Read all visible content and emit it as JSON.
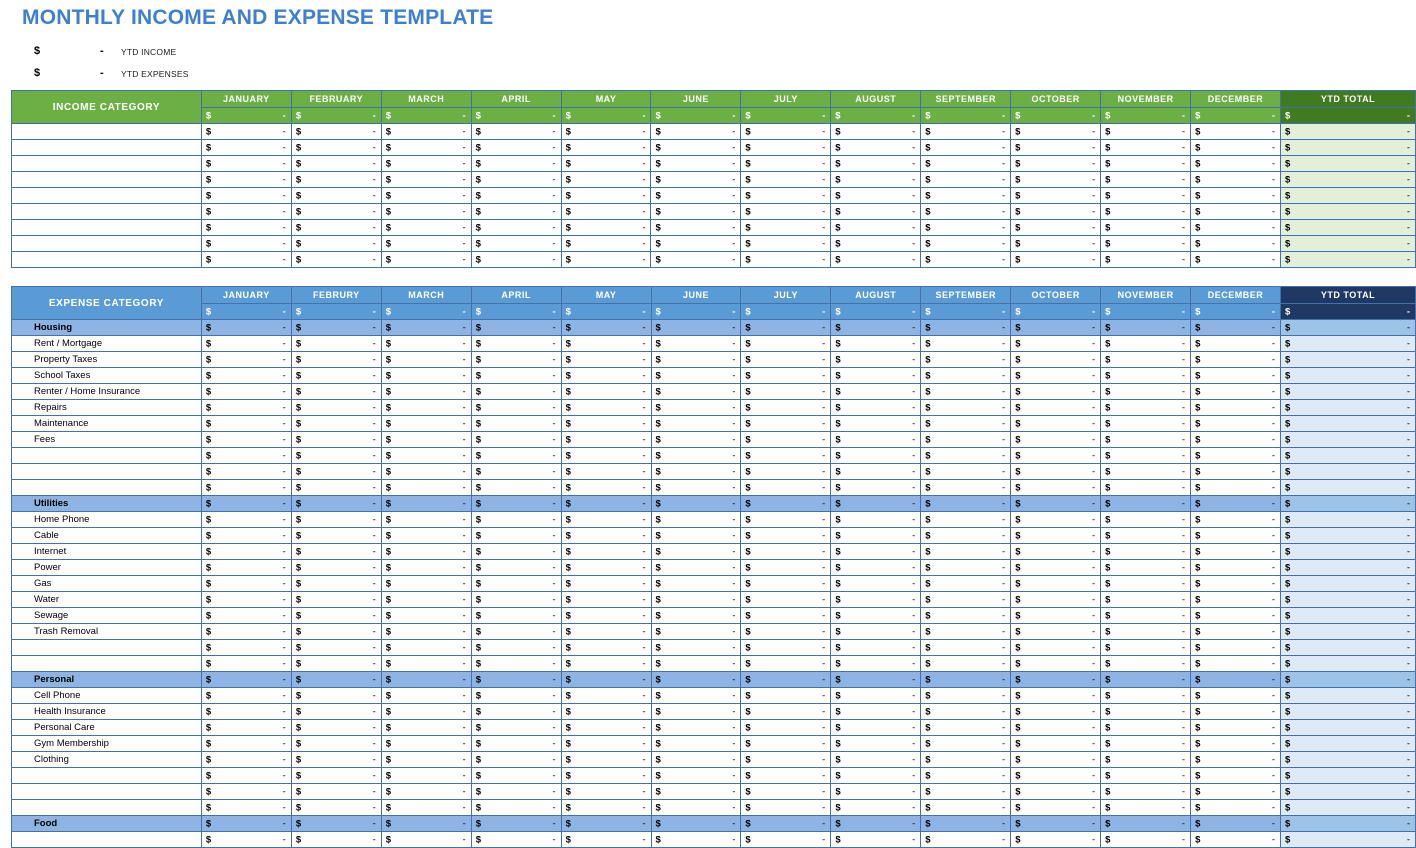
{
  "page": {
    "title": "MONTHLY INCOME AND EXPENSE TEMPLATE",
    "title_color": "#3F7FD0"
  },
  "summary": {
    "rows": [
      {
        "symbol": "$",
        "value": "-",
        "label": "YTD INCOME"
      },
      {
        "symbol": "$",
        "value": "-",
        "label": "YTD EXPENSES"
      }
    ]
  },
  "income_table": {
    "category_header": "INCOME CATEGORY",
    "months": [
      "JANUARY",
      "FEBRUARY",
      "MARCH",
      "APRIL",
      "MAY",
      "JUNE",
      "JULY",
      "AUGUST",
      "SEPTEMBER",
      "OCTOBER",
      "NOVEMBER",
      "DECEMBER"
    ],
    "ytd_header": "YTD TOTAL",
    "header_color": "#6CAF44",
    "ytd_header_color": "#417B21",
    "ytd_cell_color": "#E2EFDA",
    "currency_symbol": "$",
    "empty_value": "-",
    "total_row": {
      "months": [
        "-",
        "-",
        "-",
        "-",
        "-",
        "-",
        "-",
        "-",
        "-",
        "-",
        "-",
        "-"
      ],
      "ytd": "-"
    },
    "rows": [
      {
        "label": "",
        "months": [
          "-",
          "-",
          "-",
          "-",
          "-",
          "-",
          "-",
          "-",
          "-",
          "-",
          "-",
          "-"
        ],
        "ytd": "-"
      },
      {
        "label": "",
        "months": [
          "-",
          "-",
          "-",
          "-",
          "-",
          "-",
          "-",
          "-",
          "-",
          "-",
          "-",
          "-"
        ],
        "ytd": "-"
      },
      {
        "label": "",
        "months": [
          "-",
          "-",
          "-",
          "-",
          "-",
          "-",
          "-",
          "-",
          "-",
          "-",
          "-",
          "-"
        ],
        "ytd": "-"
      },
      {
        "label": "",
        "months": [
          "-",
          "-",
          "-",
          "-",
          "-",
          "-",
          "-",
          "-",
          "-",
          "-",
          "-",
          "-"
        ],
        "ytd": "-"
      },
      {
        "label": "",
        "months": [
          "-",
          "-",
          "-",
          "-",
          "-",
          "-",
          "-",
          "-",
          "-",
          "-",
          "-",
          "-"
        ],
        "ytd": "-"
      },
      {
        "label": "",
        "months": [
          "-",
          "-",
          "-",
          "-",
          "-",
          "-",
          "-",
          "-",
          "-",
          "-",
          "-",
          "-"
        ],
        "ytd": "-"
      },
      {
        "label": "",
        "months": [
          "-",
          "-",
          "-",
          "-",
          "-",
          "-",
          "-",
          "-",
          "-",
          "-",
          "-",
          "-"
        ],
        "ytd": "-"
      },
      {
        "label": "",
        "months": [
          "-",
          "-",
          "-",
          "-",
          "-",
          "-",
          "-",
          "-",
          "-",
          "-",
          "-",
          "-"
        ],
        "ytd": "-"
      },
      {
        "label": "",
        "months": [
          "-",
          "-",
          "-",
          "-",
          "-",
          "-",
          "-",
          "-",
          "-",
          "-",
          "-",
          "-"
        ],
        "ytd": "-"
      }
    ]
  },
  "expense_table": {
    "category_header": "EXPENSE CATEGORY",
    "months": [
      "JANUARY",
      "FEBRURY",
      "MARCH",
      "APRIL",
      "MAY",
      "JUNE",
      "JULY",
      "AUGUST",
      "SEPTEMBER",
      "OCTOBER",
      "NOVEMBER",
      "DECEMBER"
    ],
    "ytd_header": "YTD TOTAL",
    "header_color": "#5B9BD5",
    "ytd_header_color": "#1F3864",
    "ytd_cell_color": "#DEEBF7",
    "section_color": "#8EB4E3",
    "currency_symbol": "$",
    "empty_value": "-",
    "total_row": {
      "months": [
        "-",
        "-",
        "-",
        "-",
        "-",
        "-",
        "-",
        "-",
        "-",
        "-",
        "-",
        "-"
      ],
      "ytd": "-"
    },
    "rows": [
      {
        "label": "Housing",
        "type": "section",
        "months": [
          "-",
          "-",
          "-",
          "-",
          "-",
          "-",
          "-",
          "-",
          "-",
          "-",
          "-",
          "-"
        ],
        "ytd": "-"
      },
      {
        "label": "Rent / Mortgage",
        "type": "item",
        "months": [
          "-",
          "-",
          "-",
          "-",
          "-",
          "-",
          "-",
          "-",
          "-",
          "-",
          "-",
          "-"
        ],
        "ytd": "-"
      },
      {
        "label": "Property Taxes",
        "type": "item",
        "months": [
          "-",
          "-",
          "-",
          "-",
          "-",
          "-",
          "-",
          "-",
          "-",
          "-",
          "-",
          "-"
        ],
        "ytd": "-"
      },
      {
        "label": "School Taxes",
        "type": "item",
        "months": [
          "-",
          "-",
          "-",
          "-",
          "-",
          "-",
          "-",
          "-",
          "-",
          "-",
          "-",
          "-"
        ],
        "ytd": "-"
      },
      {
        "label": "Renter / Home Insurance",
        "type": "item",
        "months": [
          "-",
          "-",
          "-",
          "-",
          "-",
          "-",
          "-",
          "-",
          "-",
          "-",
          "-",
          "-"
        ],
        "ytd": "-"
      },
      {
        "label": "Repairs",
        "type": "item",
        "months": [
          "-",
          "-",
          "-",
          "-",
          "-",
          "-",
          "-",
          "-",
          "-",
          "-",
          "-",
          "-"
        ],
        "ytd": "-"
      },
      {
        "label": "Maintenance",
        "type": "item",
        "months": [
          "-",
          "-",
          "-",
          "-",
          "-",
          "-",
          "-",
          "-",
          "-",
          "-",
          "-",
          "-"
        ],
        "ytd": "-"
      },
      {
        "label": "Fees",
        "type": "item",
        "months": [
          "-",
          "-",
          "-",
          "-",
          "-",
          "-",
          "-",
          "-",
          "-",
          "-",
          "-",
          "-"
        ],
        "ytd": "-"
      },
      {
        "label": "",
        "type": "item",
        "months": [
          "-",
          "-",
          "-",
          "-",
          "-",
          "-",
          "-",
          "-",
          "-",
          "-",
          "-",
          "-"
        ],
        "ytd": "-"
      },
      {
        "label": "",
        "type": "item",
        "months": [
          "-",
          "-",
          "-",
          "-",
          "-",
          "-",
          "-",
          "-",
          "-",
          "-",
          "-",
          "-"
        ],
        "ytd": "-"
      },
      {
        "label": "",
        "type": "item",
        "months": [
          "-",
          "-",
          "-",
          "-",
          "-",
          "-",
          "-",
          "-",
          "-",
          "-",
          "-",
          "-"
        ],
        "ytd": "-"
      },
      {
        "label": "Utilities",
        "type": "section",
        "months": [
          "-",
          "-",
          "-",
          "-",
          "-",
          "-",
          "-",
          "-",
          "-",
          "-",
          "-",
          "-"
        ],
        "ytd": "-"
      },
      {
        "label": "Home Phone",
        "type": "item",
        "months": [
          "-",
          "-",
          "-",
          "-",
          "-",
          "-",
          "-",
          "-",
          "-",
          "-",
          "-",
          "-"
        ],
        "ytd": "-"
      },
      {
        "label": "Cable",
        "type": "item",
        "months": [
          "-",
          "-",
          "-",
          "-",
          "-",
          "-",
          "-",
          "-",
          "-",
          "-",
          "-",
          "-"
        ],
        "ytd": "-"
      },
      {
        "label": "Internet",
        "type": "item",
        "months": [
          "-",
          "-",
          "-",
          "-",
          "-",
          "-",
          "-",
          "-",
          "-",
          "-",
          "-",
          "-"
        ],
        "ytd": "-"
      },
      {
        "label": "Power",
        "type": "item",
        "months": [
          "-",
          "-",
          "-",
          "-",
          "-",
          "-",
          "-",
          "-",
          "-",
          "-",
          "-",
          "-"
        ],
        "ytd": "-"
      },
      {
        "label": "Gas",
        "type": "item",
        "months": [
          "-",
          "-",
          "-",
          "-",
          "-",
          "-",
          "-",
          "-",
          "-",
          "-",
          "-",
          "-"
        ],
        "ytd": "-"
      },
      {
        "label": "Water",
        "type": "item",
        "months": [
          "-",
          "-",
          "-",
          "-",
          "-",
          "-",
          "-",
          "-",
          "-",
          "-",
          "-",
          "-"
        ],
        "ytd": "-"
      },
      {
        "label": "Sewage",
        "type": "item",
        "months": [
          "-",
          "-",
          "-",
          "-",
          "-",
          "-",
          "-",
          "-",
          "-",
          "-",
          "-",
          "-"
        ],
        "ytd": "-"
      },
      {
        "label": "Trash Removal",
        "type": "item",
        "months": [
          "-",
          "-",
          "-",
          "-",
          "-",
          "-",
          "-",
          "-",
          "-",
          "-",
          "-",
          "-"
        ],
        "ytd": "-"
      },
      {
        "label": "",
        "type": "item",
        "months": [
          "-",
          "-",
          "-",
          "-",
          "-",
          "-",
          "-",
          "-",
          "-",
          "-",
          "-",
          "-"
        ],
        "ytd": "-"
      },
      {
        "label": "",
        "type": "item",
        "months": [
          "-",
          "-",
          "-",
          "-",
          "-",
          "-",
          "-",
          "-",
          "-",
          "-",
          "-",
          "-"
        ],
        "ytd": "-"
      },
      {
        "label": "Personal",
        "type": "section",
        "months": [
          "-",
          "-",
          "-",
          "-",
          "-",
          "-",
          "-",
          "-",
          "-",
          "-",
          "-",
          "-"
        ],
        "ytd": "-"
      },
      {
        "label": "Cell Phone",
        "type": "item",
        "months": [
          "-",
          "-",
          "-",
          "-",
          "-",
          "-",
          "-",
          "-",
          "-",
          "-",
          "-",
          "-"
        ],
        "ytd": "-"
      },
      {
        "label": "Health Insurance",
        "type": "item",
        "months": [
          "-",
          "-",
          "-",
          "-",
          "-",
          "-",
          "-",
          "-",
          "-",
          "-",
          "-",
          "-"
        ],
        "ytd": "-"
      },
      {
        "label": "Personal Care",
        "type": "item",
        "months": [
          "-",
          "-",
          "-",
          "-",
          "-",
          "-",
          "-",
          "-",
          "-",
          "-",
          "-",
          "-"
        ],
        "ytd": "-"
      },
      {
        "label": "Gym Membership",
        "type": "item",
        "months": [
          "-",
          "-",
          "-",
          "-",
          "-",
          "-",
          "-",
          "-",
          "-",
          "-",
          "-",
          "-"
        ],
        "ytd": "-"
      },
      {
        "label": "Clothing",
        "type": "item",
        "months": [
          "-",
          "-",
          "-",
          "-",
          "-",
          "-",
          "-",
          "-",
          "-",
          "-",
          "-",
          "-"
        ],
        "ytd": "-"
      },
      {
        "label": "",
        "type": "item",
        "months": [
          "-",
          "-",
          "-",
          "-",
          "-",
          "-",
          "-",
          "-",
          "-",
          "-",
          "-",
          "-"
        ],
        "ytd": "-"
      },
      {
        "label": "",
        "type": "item",
        "months": [
          "-",
          "-",
          "-",
          "-",
          "-",
          "-",
          "-",
          "-",
          "-",
          "-",
          "-",
          "-"
        ],
        "ytd": "-"
      },
      {
        "label": "",
        "type": "item",
        "months": [
          "-",
          "-",
          "-",
          "-",
          "-",
          "-",
          "-",
          "-",
          "-",
          "-",
          "-",
          "-"
        ],
        "ytd": "-"
      },
      {
        "label": "Food",
        "type": "section",
        "months": [
          "-",
          "-",
          "-",
          "-",
          "-",
          "-",
          "-",
          "-",
          "-",
          "-",
          "-",
          "-"
        ],
        "ytd": "-"
      },
      {
        "label": "",
        "type": "item",
        "months": [
          "-",
          "-",
          "-",
          "-",
          "-",
          "-",
          "-",
          "-",
          "-",
          "-",
          "-",
          "-"
        ],
        "ytd": "-"
      }
    ]
  }
}
